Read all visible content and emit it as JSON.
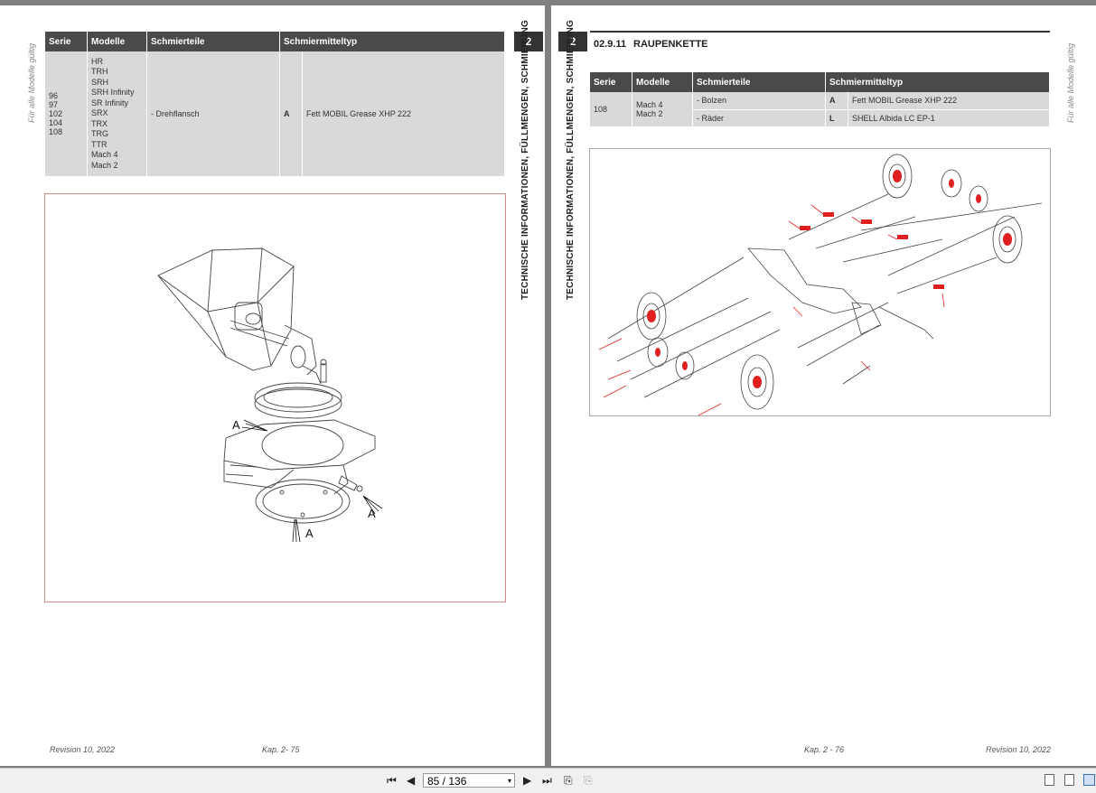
{
  "left_page": {
    "side_note": "Für alle Modelle gültig",
    "chapter": "2",
    "vertical_title": "TECHNISCHE INFORMATIONEN, FÜLLMENGEN, SCHMIERUNG",
    "table": {
      "headers": [
        "Serie",
        "Modelle",
        "Schmierteile",
        "Schmiermitteltyp"
      ],
      "serie": "96\n97\n102\n104\n108",
      "modelle": "HR\nTRH\nSRH\nSRH Infinity\nSR Infinity\nSRX\nTRX\nTRG\nTTR\nMach 4\nMach 2",
      "schmierteile": "- Drehflansch",
      "code": "A",
      "type": "Fett MOBIL Grease XHP 222"
    },
    "figure_labels": [
      "A",
      "A",
      "A"
    ],
    "footer_left": "Revision 10, 2022",
    "footer_center": "Kap. 2- 75"
  },
  "right_page": {
    "chapter": "2",
    "vertical_title": "TECHNISCHE INFORMATIONEN, FÜLLMENGEN, SCHMIERUNG",
    "side_note": "Für alle Modelle gültig",
    "section_number": "02.9.11",
    "section_title": "RAUPENKETTE",
    "table": {
      "headers": [
        "Serie",
        "Modelle",
        "Schmierteile",
        "Schmiermitteltyp"
      ],
      "serie": "108",
      "modelle": "Mach 4\nMach 2",
      "rows": [
        {
          "part": "- Bolzen",
          "code": "A",
          "type": "Fett MOBIL Grease XHP 222"
        },
        {
          "part": "- Räder",
          "code": "L",
          "type": "SHELL Albida LC EP-1"
        }
      ]
    },
    "footer_center": "Kap. 2 - 76",
    "footer_right": "Revision 10, 2022"
  },
  "toolbar": {
    "page_indicator": "85 / 136"
  },
  "colors": {
    "accent_red": "#e02020",
    "header_gray": "#4a4a4a",
    "cell_gray": "#d9d9d9"
  }
}
